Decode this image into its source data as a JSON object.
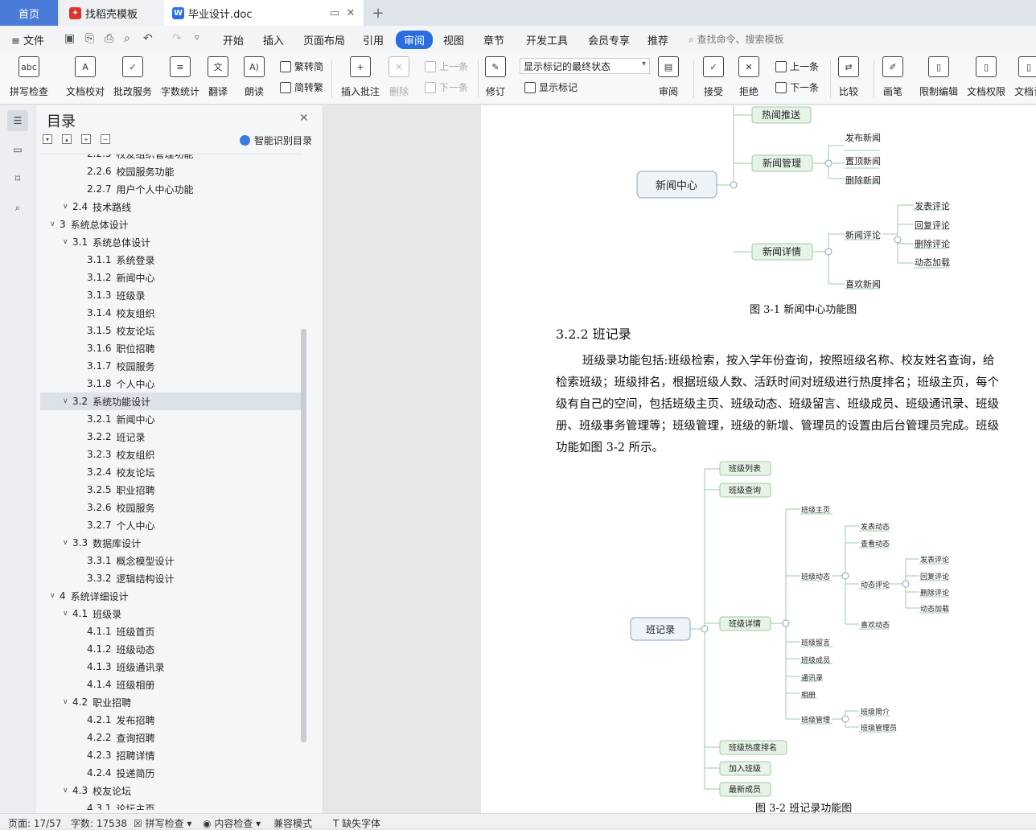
{
  "tabs": {
    "home": "首页",
    "template": "找稻壳模板",
    "doc": "毕业设计.doc"
  },
  "menu": [
    "开始",
    "插入",
    "页面布局",
    "引用",
    "审阅",
    "视图",
    "章节",
    "开发工具",
    "会员专享",
    "推荐"
  ],
  "file_label": "文件",
  "search_placeholder": "查找命令、搜索模板",
  "ribbon": {
    "spell": "拼写检查",
    "proof": "文档校对",
    "batch": "批改服务",
    "wordcount": "字数统计",
    "translate": "翻译",
    "read": "朗读",
    "trad": "繁转简",
    "simp": "简转繁",
    "insert_comment": "插入批注",
    "delete": "删除",
    "prev_comment": "上一条",
    "next_comment": "下一条",
    "revise": "修订",
    "markup_state": "显示标记的最终状态",
    "show_markup": "显示标记",
    "review": "审阅",
    "accept": "接受",
    "reject": "拒绝",
    "prev_change": "上一条",
    "next_change": "下一条",
    "compare": "比较",
    "pen": "画笔",
    "restrict": "限制编辑",
    "rights": "文档权限",
    "cert": "文档认"
  },
  "toc": {
    "title": "目录",
    "smart": "智能识别目录",
    "items": [
      {
        "num": "2.2.5",
        "text": "校友组织管理功能",
        "level": 3
      },
      {
        "num": "2.2.6",
        "text": "校园服务功能",
        "level": 3
      },
      {
        "num": "2.2.7",
        "text": "用户个人中心功能",
        "level": 3
      },
      {
        "num": "2.4",
        "text": "技术路线",
        "level": 2
      },
      {
        "num": "3",
        "text": "系统总体设计",
        "level": 1
      },
      {
        "num": "3.1",
        "text": "系统总体设计",
        "level": 2
      },
      {
        "num": "3.1.1",
        "text": "系统登录",
        "level": 3
      },
      {
        "num": "3.1.2",
        "text": "新闻中心",
        "level": 3
      },
      {
        "num": "3.1.3",
        "text": "班级录",
        "level": 3
      },
      {
        "num": "3.1.4",
        "text": "校友组织",
        "level": 3
      },
      {
        "num": "3.1.5",
        "text": "校友论坛",
        "level": 3
      },
      {
        "num": "3.1.6",
        "text": "职位招聘",
        "level": 3
      },
      {
        "num": "3.1.7",
        "text": "校园服务",
        "level": 3
      },
      {
        "num": "3.1.8",
        "text": "个人中心",
        "level": 3
      },
      {
        "num": "3.2",
        "text": "系统功能设计",
        "level": 2
      },
      {
        "num": "3.2.1",
        "text": "新闻中心",
        "level": 3
      },
      {
        "num": "3.2.2",
        "text": "班记录",
        "level": 3
      },
      {
        "num": "3.2.3",
        "text": "校友组织",
        "level": 3
      },
      {
        "num": "3.2.4",
        "text": "校友论坛",
        "level": 3
      },
      {
        "num": "3.2.5",
        "text": "职业招聘",
        "level": 3
      },
      {
        "num": "3.2.6",
        "text": "校园服务",
        "level": 3
      },
      {
        "num": "3.2.7",
        "text": "个人中心",
        "level": 3
      },
      {
        "num": "3.3",
        "text": "数据库设计",
        "level": 2
      },
      {
        "num": "3.3.1",
        "text": "概念模型设计",
        "level": 3
      },
      {
        "num": "3.3.2",
        "text": "逻辑结构设计",
        "level": 3
      },
      {
        "num": "4",
        "text": "系统详细设计",
        "level": 1
      },
      {
        "num": "4.1",
        "text": "班级录",
        "level": 2
      },
      {
        "num": "4.1.1",
        "text": "班级首页",
        "level": 3
      },
      {
        "num": "4.1.2",
        "text": "班级动态",
        "level": 3
      },
      {
        "num": "4.1.3",
        "text": "班级通讯录",
        "level": 3
      },
      {
        "num": "4.1.4",
        "text": "班级相册",
        "level": 3
      },
      {
        "num": "4.2",
        "text": "职业招聘",
        "level": 2
      },
      {
        "num": "4.2.1",
        "text": "发布招聘",
        "level": 3
      },
      {
        "num": "4.2.2",
        "text": "查询招聘",
        "level": 3
      },
      {
        "num": "4.2.3",
        "text": "招聘详情",
        "level": 3
      },
      {
        "num": "4.2.4",
        "text": "投递简历",
        "level": 3
      },
      {
        "num": "4.3",
        "text": "校友论坛",
        "level": 2
      },
      {
        "num": "4.3.1",
        "text": "论坛主页",
        "level": 3
      }
    ]
  },
  "doc": {
    "fig1": {
      "root": "新闻中心",
      "push": "热闻推送",
      "manage": "新闻管理",
      "manage_items": [
        "发布新闻",
        "置顶新闻",
        "删除新闻"
      ],
      "detail": "新闻详情",
      "comment": "新闻评论",
      "comment_items": [
        "发表评论",
        "回复评论",
        "删除评论",
        "动态加载"
      ],
      "like": "喜欢新闻",
      "caption": "图 3-1  新闻中心功能图"
    },
    "heading": "3.2.2  班记录",
    "para": [
      "班级录功能包括:班级检索，按入学年份查询，按照班级名称、校友姓名查询，给",
      "检索班级；班级排名，根据班级人数、活跃时间对班级进行热度排名；班级主页，每个",
      "级有自己的空间，包括班级主页、班级动态、班级留言、班级成员、班级通讯录、班级",
      "册、班级事务管理等；班级管理，班级的新增、管理员的设置由后台管理员完成。班级",
      "功能如图 3-2 所示。"
    ],
    "fig2": {
      "root": "班记录",
      "list": "班级列表",
      "query": "班级查询",
      "detail": "班级详情",
      "home": "班级主页",
      "dynamic": "班级动态",
      "post": "发表动态",
      "view": "查看动态",
      "dcomment": "动态评论",
      "dcomment_items": [
        "发表评论",
        "回复评论",
        "删除评论",
        "动态加载"
      ],
      "like": "喜欢动态",
      "msg": "班级留言",
      "members": "班级成员",
      "contacts": "通讯录",
      "album": "相册",
      "admin": "班级管理",
      "intro": "班级简介",
      "admins": "班级管理员",
      "hot": "班级热度排名",
      "join": "加入班级",
      "newmem": "最新成员",
      "caption": "图 3-2  班记录功能图"
    }
  },
  "status": {
    "page": "页面: 17/57",
    "words": "字数: 17538",
    "spell": "拼写检查",
    "content": "内容检查",
    "compat": "兼容模式",
    "font": "缺失字体"
  }
}
